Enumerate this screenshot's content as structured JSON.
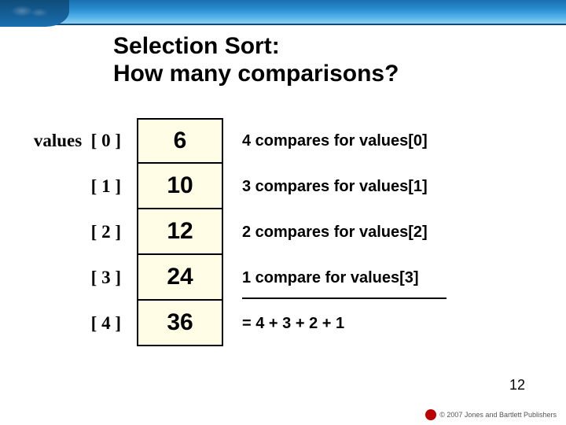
{
  "title_line1": "Selection Sort:",
  "title_line2": "How many comparisons?",
  "array_name": "values",
  "rows": [
    {
      "index": "[ 0 ]",
      "value": "6",
      "note": "4 compares for values[0]"
    },
    {
      "index": "[ 1 ]",
      "value": "10",
      "note": "3 compares for values[1]"
    },
    {
      "index": "[ 2 ]",
      "value": "12",
      "note": "2 compares for values[2]"
    },
    {
      "index": "[ 3 ]",
      "value": "24",
      "note": "1 compare for values[3]"
    },
    {
      "index": "[ 4 ]",
      "value": "36",
      "note": "=  4  +  3  +  2  +  1"
    }
  ],
  "page_number": "12",
  "copyright": "© 2007 Jones and Bartlett Publishers"
}
